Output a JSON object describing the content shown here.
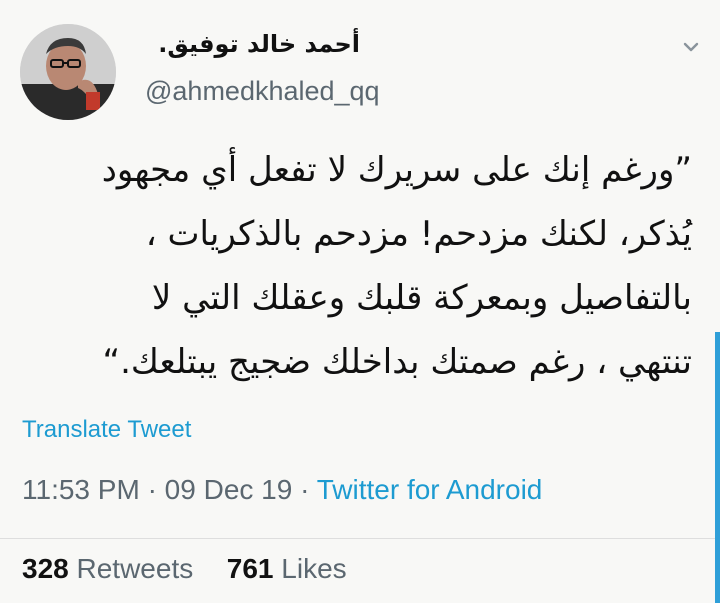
{
  "author": {
    "name": "أحمد خالد توفيق.",
    "handle": "@ahmedkhaled_qq",
    "avatar_icon": "profile-photo"
  },
  "menu_icon": "chevron-down-icon",
  "tweet": {
    "lines": [
      "”ورغم إنك على سريرك لا تفعل أي مجهود",
      "يُذكر، لكنك مزدحم! مزدحم بالذكريات ،",
      "بالتفاصيل وبمعركة قلبك وعقلك التي لا",
      "تنتهي ، رغم صمتك بداخلك ضجيج يبتلعك.“"
    ]
  },
  "translate_label": "Translate Tweet",
  "meta": {
    "time": "11:53 PM",
    "separator": "·",
    "date": "09 Dec 19",
    "source": "Twitter for Android"
  },
  "stats": {
    "retweets_count": "328",
    "retweets_label": "Retweets",
    "likes_count": "761",
    "likes_label": "Likes"
  },
  "colors": {
    "link": "#1d9bd1",
    "muted": "#5b6770",
    "text": "#111111"
  }
}
